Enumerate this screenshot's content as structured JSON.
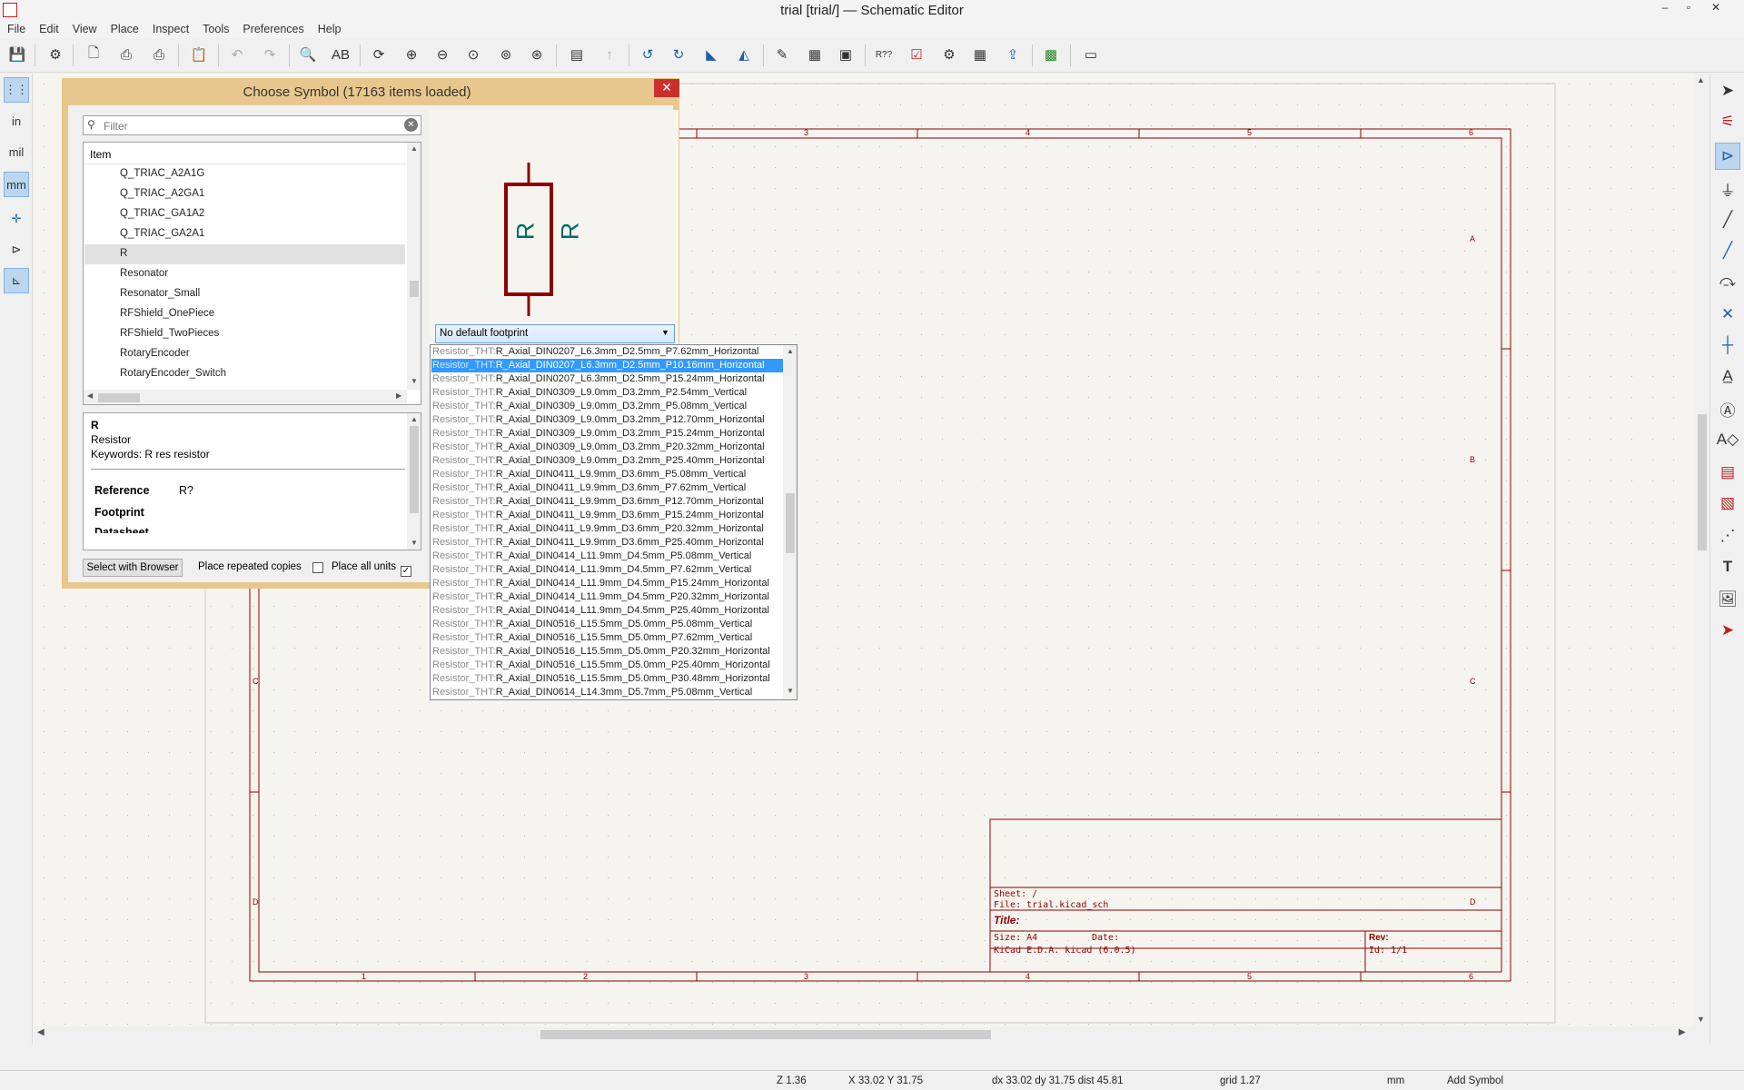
{
  "window": {
    "title": "trial [trial/] — Schematic Editor",
    "minimize": "–",
    "restore": "▫",
    "close": "✕"
  },
  "menu": [
    "File",
    "Edit",
    "View",
    "Place",
    "Inspect",
    "Tools",
    "Preferences",
    "Help"
  ],
  "left_toolbar": {
    "units_in": "in",
    "units_mil": "mil",
    "units_mm": "mm"
  },
  "dialog": {
    "title": "Choose Symbol (17163 items loaded)",
    "close": "✕",
    "filter_placeholder": "Filter",
    "list_header": "Item",
    "items": [
      "Q_TRIAC_A2A1G",
      "Q_TRIAC_A2GA1",
      "Q_TRIAC_GA1A2",
      "Q_TRIAC_GA2A1",
      "R",
      "Resonator",
      "Resonator_Small",
      "RFShield_OnePiece",
      "RFShield_TwoPieces",
      "RotaryEncoder",
      "RotaryEncoder_Switch"
    ],
    "selected_item": "R",
    "details": {
      "name": "R",
      "description": "Resistor",
      "keywords": "Keywords: R res resistor",
      "reference_label": "Reference",
      "reference_value": "R?",
      "footprint_label": "Footprint",
      "datasheet_partial": "Datasheet"
    },
    "preview": {
      "ref": "R",
      "value": "R"
    },
    "footprint_select": "No default footprint",
    "footprints": [
      [
        "Resistor_THT:",
        "R_Axial_DIN0207_L6.3mm_D2.5mm_P7.62mm_Horizontal"
      ],
      [
        "Resistor_THT:",
        "R_Axial_DIN0207_L6.3mm_D2.5mm_P10.16mm_Horizontal"
      ],
      [
        "Resistor_THT:",
        "R_Axial_DIN0207_L6.3mm_D2.5mm_P15.24mm_Horizontal"
      ],
      [
        "Resistor_THT:",
        "R_Axial_DIN0309_L9.0mm_D3.2mm_P2.54mm_Vertical"
      ],
      [
        "Resistor_THT:",
        "R_Axial_DIN0309_L9.0mm_D3.2mm_P5.08mm_Vertical"
      ],
      [
        "Resistor_THT:",
        "R_Axial_DIN0309_L9.0mm_D3.2mm_P12.70mm_Horizontal"
      ],
      [
        "Resistor_THT:",
        "R_Axial_DIN0309_L9.0mm_D3.2mm_P15.24mm_Horizontal"
      ],
      [
        "Resistor_THT:",
        "R_Axial_DIN0309_L9.0mm_D3.2mm_P20.32mm_Horizontal"
      ],
      [
        "Resistor_THT:",
        "R_Axial_DIN0309_L9.0mm_D3.2mm_P25.40mm_Horizontal"
      ],
      [
        "Resistor_THT:",
        "R_Axial_DIN0411_L9.9mm_D3.6mm_P5.08mm_Vertical"
      ],
      [
        "Resistor_THT:",
        "R_Axial_DIN0411_L9.9mm_D3.6mm_P7.62mm_Vertical"
      ],
      [
        "Resistor_THT:",
        "R_Axial_DIN0411_L9.9mm_D3.6mm_P12.70mm_Horizontal"
      ],
      [
        "Resistor_THT:",
        "R_Axial_DIN0411_L9.9mm_D3.6mm_P15.24mm_Horizontal"
      ],
      [
        "Resistor_THT:",
        "R_Axial_DIN0411_L9.9mm_D3.6mm_P20.32mm_Horizontal"
      ],
      [
        "Resistor_THT:",
        "R_Axial_DIN0411_L9.9mm_D3.6mm_P25.40mm_Horizontal"
      ],
      [
        "Resistor_THT:",
        "R_Axial_DIN0414_L11.9mm_D4.5mm_P5.08mm_Vertical"
      ],
      [
        "Resistor_THT:",
        "R_Axial_DIN0414_L11.9mm_D4.5mm_P7.62mm_Vertical"
      ],
      [
        "Resistor_THT:",
        "R_Axial_DIN0414_L11.9mm_D4.5mm_P15.24mm_Horizontal"
      ],
      [
        "Resistor_THT:",
        "R_Axial_DIN0414_L11.9mm_D4.5mm_P20.32mm_Horizontal"
      ],
      [
        "Resistor_THT:",
        "R_Axial_DIN0414_L11.9mm_D4.5mm_P25.40mm_Horizontal"
      ],
      [
        "Resistor_THT:",
        "R_Axial_DIN0516_L15.5mm_D5.0mm_P5.08mm_Vertical"
      ],
      [
        "Resistor_THT:",
        "R_Axial_DIN0516_L15.5mm_D5.0mm_P7.62mm_Vertical"
      ],
      [
        "Resistor_THT:",
        "R_Axial_DIN0516_L15.5mm_D5.0mm_P20.32mm_Horizontal"
      ],
      [
        "Resistor_THT:",
        "R_Axial_DIN0516_L15.5mm_D5.0mm_P25.40mm_Horizontal"
      ],
      [
        "Resistor_THT:",
        "R_Axial_DIN0516_L15.5mm_D5.0mm_P30.48mm_Horizontal"
      ],
      [
        "Resistor_THT:",
        "R_Axial_DIN0614_L14.3mm_D5.7mm_P5.08mm_Vertical"
      ]
    ],
    "selected_footprint_index": 1,
    "select_browser": "Select with Browser",
    "place_repeated": "Place repeated copies",
    "place_all_units": "Place all units",
    "place_all_units_check": "✓"
  },
  "sheet": {
    "top_cols": [
      "3",
      "4",
      "5"
    ],
    "bottom_cols": [
      "1",
      "2",
      "3",
      "4",
      "5"
    ],
    "col_last": "6",
    "rows": [
      "A",
      "B",
      "C",
      "D"
    ],
    "left_rows": [
      "C",
      "D"
    ],
    "title_block": {
      "sheet": "Sheet: /",
      "file": "File: trial.kicad_sch",
      "title": "Title:",
      "size": "Size: A4",
      "date": "Date:",
      "rev": "Rev:",
      "kicad": "KiCad E.D.A.  kicad (6.0.5)",
      "id": "Id: 1/1"
    }
  },
  "status": {
    "zoom": "Z 1.36",
    "xy": "X 33.02  Y 31.75",
    "delta": "dx 33.02  dy 31.75  dist 45.81",
    "grid": "grid 1.27",
    "units": "mm",
    "mode": "Add Symbol"
  },
  "colors": {
    "border": "#8f0000",
    "symbol": "#8f0000",
    "symbol_text": "#006a6a",
    "highlight": "#3399ff",
    "dialog_frame": "#e8c78e"
  }
}
